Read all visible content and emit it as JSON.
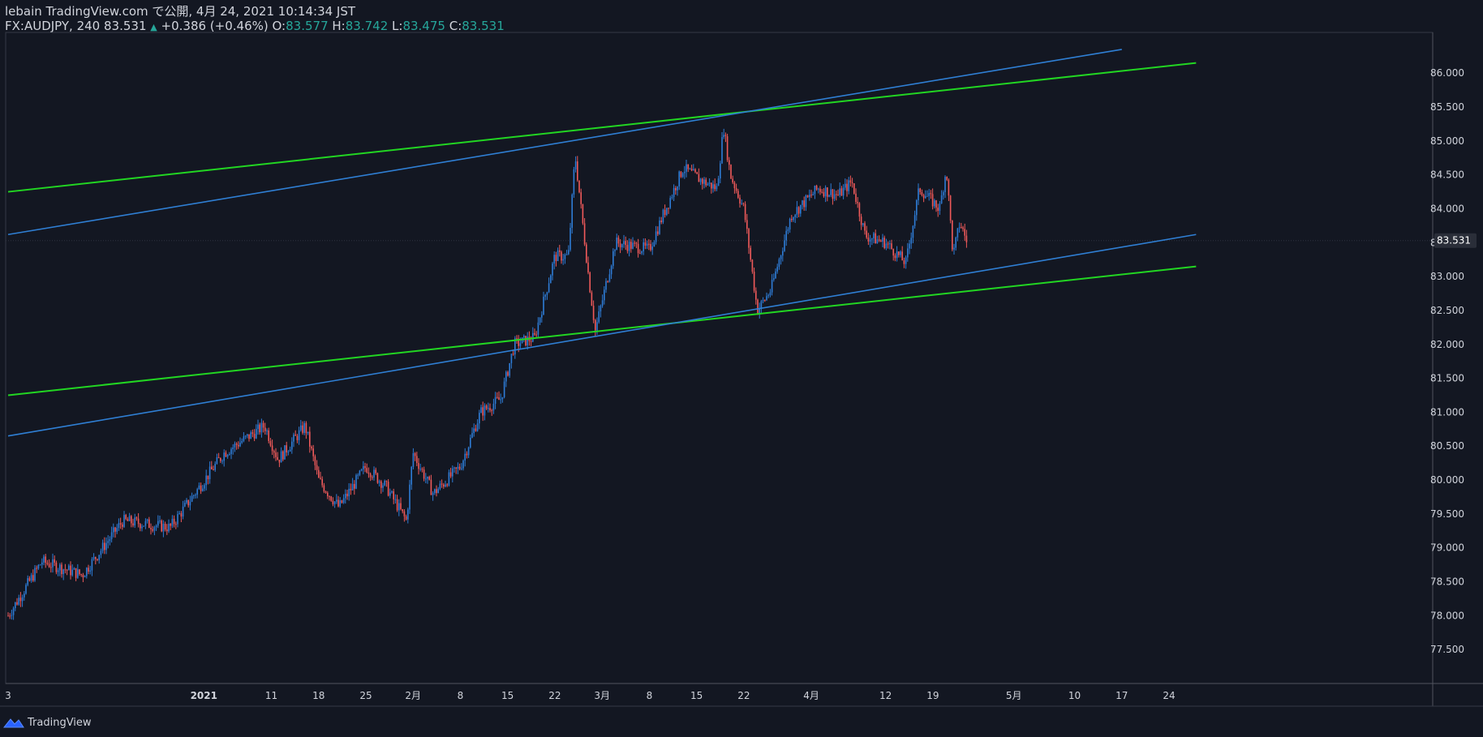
{
  "header": {
    "line1": "lebain TradingView.com で公開, 4月 24, 2021 10:14:34 JST",
    "symbol": "FX:AUDJPY, 240",
    "last": "83.531",
    "arrow": "▲",
    "change": "+0.386 (+0.46%)",
    "o_label": "O:",
    "o_value": "83.577",
    "h_label": "H:",
    "h_value": "83.742",
    "l_label": "L:",
    "l_value": "83.475",
    "c_label": "C:",
    "c_value": "83.531"
  },
  "footer": {
    "brand": "TradingView",
    "logo_icon": "tradingview-logo-icon"
  },
  "colors": {
    "background": "#131722",
    "up": "#2e7cd6",
    "down": "#ef5a5a",
    "green_line": "#22d622",
    "blue_line": "#2f7fd4",
    "text": "#d1d4dc",
    "axis": "#363a45"
  },
  "chart_data": {
    "type": "candlestick",
    "symbol": "FX:AUDJPY",
    "interval": "240",
    "ylim": [
      77.0,
      86.6
    ],
    "y_ticks": [
      "77.500",
      "78.000",
      "78.500",
      "79.000",
      "79.500",
      "80.000",
      "80.500",
      "81.000",
      "81.500",
      "82.000",
      "82.500",
      "83.000",
      "83.500",
      "84.000",
      "84.500",
      "85.000",
      "85.500",
      "86.000"
    ],
    "last_price_label": "83.531",
    "x_ticks": [
      "3",
      "2021",
      "11",
      "18",
      "25",
      "2月",
      "8",
      "15",
      "22",
      "3月",
      "8",
      "15",
      "22",
      "4月",
      "12",
      "19",
      "5月",
      "10",
      "17",
      "24"
    ],
    "x_tick_dates": [
      "2020-12-03",
      "2021-01-01",
      "2021-01-11",
      "2021-01-18",
      "2021-01-25",
      "2021-02-01",
      "2021-02-08",
      "2021-02-15",
      "2021-02-22",
      "2021-03-01",
      "2021-03-08",
      "2021-03-15",
      "2021-03-22",
      "2021-04-01",
      "2021-04-12",
      "2021-04-19",
      "2021-05-01",
      "2021-05-10",
      "2021-05-17",
      "2021-05-24"
    ],
    "price_path": [
      {
        "date": "2020-12-03",
        "close": 78.0
      },
      {
        "date": "2020-12-08",
        "close": 78.8
      },
      {
        "date": "2020-12-14",
        "close": 78.6
      },
      {
        "date": "2020-12-20",
        "close": 79.4
      },
      {
        "date": "2020-12-27",
        "close": 79.3
      },
      {
        "date": "2021-01-04",
        "close": 80.4
      },
      {
        "date": "2021-01-10",
        "close": 80.8
      },
      {
        "date": "2021-01-12",
        "close": 80.3
      },
      {
        "date": "2021-01-16",
        "close": 80.8
      },
      {
        "date": "2021-01-18",
        "close": 80.0
      },
      {
        "date": "2021-01-21",
        "close": 79.6
      },
      {
        "date": "2021-01-25",
        "close": 80.2
      },
      {
        "date": "2021-01-28",
        "close": 79.9
      },
      {
        "date": "2021-01-31",
        "close": 79.4
      },
      {
        "date": "2021-02-01",
        "close": 80.4
      },
      {
        "date": "2021-02-04",
        "close": 79.8
      },
      {
        "date": "2021-02-08",
        "close": 80.2
      },
      {
        "date": "2021-02-11",
        "close": 81.0
      },
      {
        "date": "2021-02-14",
        "close": 81.2
      },
      {
        "date": "2021-02-16",
        "close": 82.0
      },
      {
        "date": "2021-02-19",
        "close": 82.1
      },
      {
        "date": "2021-02-22",
        "close": 83.3
      },
      {
        "date": "2021-02-24",
        "close": 83.3
      },
      {
        "date": "2021-02-25",
        "close": 84.8
      },
      {
        "date": "2021-02-27",
        "close": 83.0
      },
      {
        "date": "2021-02-28",
        "close": 82.2
      },
      {
        "date": "2021-03-03",
        "close": 83.5
      },
      {
        "date": "2021-03-08",
        "close": 83.4
      },
      {
        "date": "2021-03-10",
        "close": 83.9
      },
      {
        "date": "2021-03-13",
        "close": 84.6
      },
      {
        "date": "2021-03-16",
        "close": 84.4
      },
      {
        "date": "2021-03-18",
        "close": 84.3
      },
      {
        "date": "2021-03-19",
        "close": 85.2
      },
      {
        "date": "2021-03-20",
        "close": 84.5
      },
      {
        "date": "2021-03-22",
        "close": 84.0
      },
      {
        "date": "2021-03-24",
        "close": 82.5
      },
      {
        "date": "2021-03-26",
        "close": 82.8
      },
      {
        "date": "2021-03-29",
        "close": 83.9
      },
      {
        "date": "2021-04-02",
        "close": 84.3
      },
      {
        "date": "2021-04-05",
        "close": 84.2
      },
      {
        "date": "2021-04-07",
        "close": 84.4
      },
      {
        "date": "2021-04-09",
        "close": 83.6
      },
      {
        "date": "2021-04-12",
        "close": 83.5
      },
      {
        "date": "2021-04-15",
        "close": 83.2
      },
      {
        "date": "2021-04-17",
        "close": 84.3
      },
      {
        "date": "2021-04-20",
        "close": 84.0
      },
      {
        "date": "2021-04-21",
        "close": 84.6
      },
      {
        "date": "2021-04-22",
        "close": 83.3
      },
      {
        "date": "2021-04-23",
        "close": 83.8
      },
      {
        "date": "2021-04-24",
        "close": 83.531
      }
    ],
    "trendlines": [
      {
        "color": "green",
        "p1": {
          "date": "2020-12-03",
          "price": 84.25
        },
        "p2": {
          "date": "2021-05-28",
          "price": 86.15
        }
      },
      {
        "color": "green",
        "p1": {
          "date": "2020-12-03",
          "price": 81.25
        },
        "p2": {
          "date": "2021-05-28",
          "price": 83.15
        }
      },
      {
        "color": "blue",
        "p1": {
          "date": "2020-12-03",
          "price": 83.62
        },
        "p2": {
          "date": "2021-05-17",
          "price": 86.35
        }
      },
      {
        "color": "blue",
        "p1": {
          "date": "2020-12-03",
          "price": 80.65
        },
        "p2": {
          "date": "2021-05-28",
          "price": 83.62
        }
      }
    ]
  }
}
